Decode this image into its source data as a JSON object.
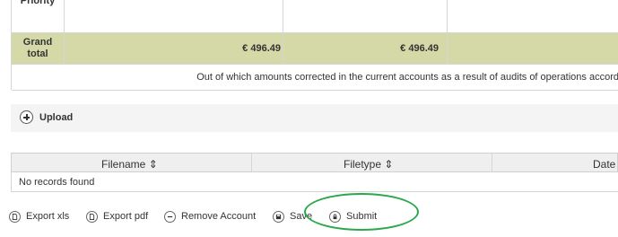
{
  "summary_table": {
    "priority_label": "Priority",
    "grand_total_label_line1": "Grand",
    "grand_total_label_line2": "total",
    "amount_1": "€ 496.49",
    "amount_2": "€ 496.49",
    "note": "Out of which amounts corrected in the current accounts as a result of audits of operations accord"
  },
  "upload": {
    "label": "Upload"
  },
  "files_table": {
    "columns": [
      "Filename ⇕",
      "Filetype ⇕",
      "Date"
    ],
    "empty_text": "No records found"
  },
  "actions": {
    "export_xls": "Export xls",
    "export_pdf": "Export pdf",
    "remove_account": "Remove Account",
    "save": "Save",
    "submit": "Submit"
  },
  "colors": {
    "grand_total_row": "#d5d9a8",
    "annotation": "#2aa84a"
  }
}
